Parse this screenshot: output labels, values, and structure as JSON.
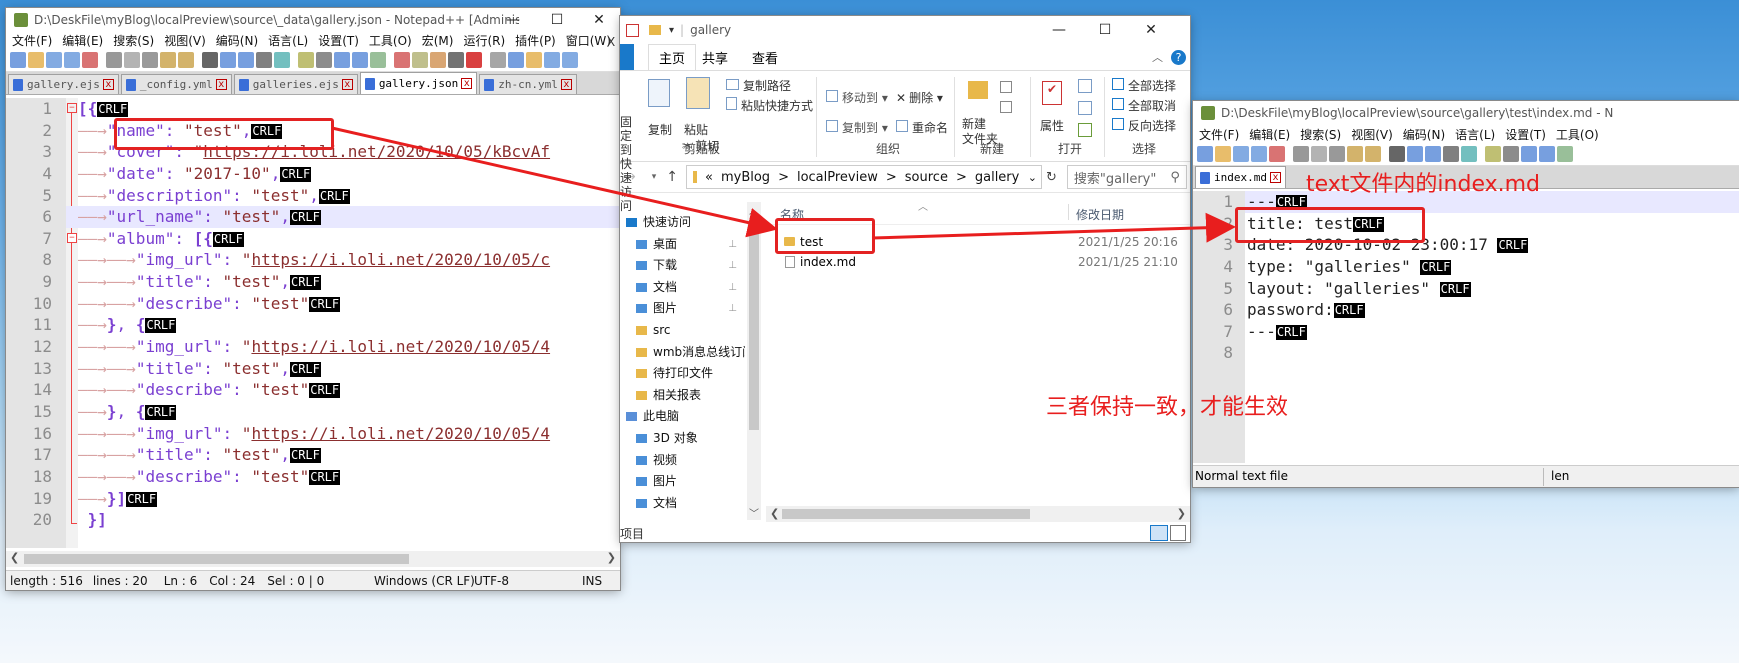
{
  "notepad": {
    "title": "D:\\DeskFile\\myBlog\\localPreview\\source\\_data\\gallery.json - Notepad++ [Administrat...",
    "menu": [
      "文件(F)",
      "编辑(E)",
      "搜索(S)",
      "视图(V)",
      "编码(N)",
      "语言(L)",
      "设置(T)",
      "工具(O)",
      "宏(M)",
      "运行(R)",
      "插件(P)",
      "窗口(W)",
      "?"
    ],
    "menu_close": "X",
    "tabs": [
      "gallery.ejs",
      "_config.yml",
      "galleries.ejs",
      "gallery.json",
      "zh-cn.yml"
    ],
    "active_tab": 3,
    "line_numbers": [
      "1",
      "2",
      "3",
      "4",
      "5",
      "6",
      "7",
      "8",
      "9",
      "10",
      "11",
      "12",
      "13",
      "14",
      "15",
      "16",
      "17",
      "18",
      "19",
      "20"
    ],
    "crlf": "CRLF",
    "tab_arrow": "——→",
    "lines": [
      "[{",
      "\"name\": \"test\",",
      "\"cover\": \"https://i.loli.net/2020/10/05/kBcvAf",
      "\"date\": \"2017-10\",",
      "\"description\": \"test\",",
      "\"url_name\": \"test\",",
      "\"album\": [{",
      "\"img_url\": \"https://i.loli.net/2020/10/05/c",
      "\"title\": \"test\",",
      "\"describe\": \"test\"",
      "}, {",
      "\"img_url\": \"https://i.loli.net/2020/10/05/4",
      "\"title\": \"test\",",
      "\"describe\": \"test\"",
      "}, {",
      "\"img_url\": \"https://i.loli.net/2020/10/05/4",
      "\"title\": \"test\",",
      "\"describe\": \"test\"",
      "}]",
      "}]"
    ],
    "status": {
      "length": "length : 516",
      "lines": "lines : 20",
      "ln": "Ln : 6",
      "col": "Col : 24",
      "sel": "Sel : 0 | 0",
      "eol": "Windows (CR LF)",
      "enc": "UTF-8",
      "ins": "INS"
    }
  },
  "explorer": {
    "title": "gallery",
    "tabs": [
      "主页",
      "共享",
      "查看"
    ],
    "ribbon": {
      "clipboard": {
        "label": "剪贴板",
        "pin": "固定到快速访问",
        "copy": "复制",
        "paste": "粘贴",
        "copy_path": "复制路径",
        "paste_shortcut": "粘贴快捷方式",
        "cut": "剪切"
      },
      "organize": {
        "label": "组织",
        "move_to": "移动到",
        "copy_to": "复制到",
        "delete": "删除",
        "rename": "重命名"
      },
      "new": {
        "label": "新建",
        "new_folder": "新建\n文件夹"
      },
      "open": {
        "label": "打开",
        "properties": "属性"
      },
      "select": {
        "label": "选择",
        "select_all": "全部选择",
        "select_none": "全部取消",
        "invert": "反向选择"
      }
    },
    "path": [
      "«",
      "myBlog",
      ">",
      "localPreview",
      ">",
      "source",
      ">",
      "gallery"
    ],
    "search_placeholder": "搜索\"gallery\"",
    "sidebar": [
      "快速访问",
      "桌面",
      "下载",
      "文档",
      "图片",
      "src",
      "wmb消息总线订阅发布",
      "待打印文件",
      "相关报表",
      "此电脑",
      "3D 对象",
      "视频",
      "图片",
      "文档"
    ],
    "columns": {
      "name": "名称",
      "modified": "修改日期"
    },
    "files": [
      {
        "name": "test",
        "date": "2021/1/25 20:16",
        "type": "folder"
      },
      {
        "name": "index.md",
        "date": "2021/1/25 21:10",
        "type": "file"
      }
    ],
    "status_items": "项目"
  },
  "notepad2": {
    "title": "D:\\DeskFile\\myBlog\\localPreview\\source\\gallery\\test\\index.md - N",
    "menu": [
      "文件(F)",
      "编辑(E)",
      "搜索(S)",
      "视图(V)",
      "编码(N)",
      "语言(L)",
      "设置(T)",
      "工具(O)"
    ],
    "tab": "index.md",
    "line_numbers": [
      "1",
      "2",
      "3",
      "4",
      "5",
      "6",
      "7",
      "8"
    ],
    "lines": [
      "---",
      "title: test",
      "date: 2020-10-02 23:00:17 ",
      "type: \"galleries\" ",
      "layout: \"galleries\" ",
      "password:",
      "---",
      ""
    ],
    "status_left": "Normal text file",
    "status_right": "len"
  },
  "annotations": {
    "text_label": "text文件内的index.md",
    "consistency_note": "三者保持一致，才能生效"
  },
  "colors": {
    "accent_red": "#e81e1e",
    "explorer_blue": "#1979ca",
    "crlf_bg": "#000000"
  }
}
